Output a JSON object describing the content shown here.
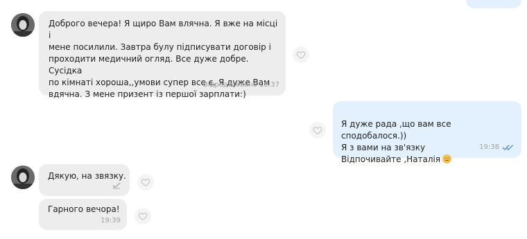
{
  "chat": {
    "messages": [
      {
        "id": "m1",
        "direction": "incoming",
        "lines": "Доброго вечера! Я щиро Вам влячна. Я вже на місці і\nмене посилили. Завтра булу підписувати договір і\nпроходити медичний огляд. Все дуже добре. Сусідка\nпо кімнаті хороша,,умови супер все є. Я дуже Вам\nвдячна. З мене призент із першої зарплати:)",
        "status": "Відредаговано",
        "time": "19:37"
      },
      {
        "id": "m2",
        "direction": "outgoing",
        "lines": "Я дуже рада ,що вам все сподобалося.))\nЯ з вами на зв'язку\nВідпочивайте ,Наталія",
        "emoji": "smiling-face-icon",
        "time": "19:38",
        "read_status": "double-check-icon"
      },
      {
        "id": "m3",
        "direction": "incoming",
        "lines": "Дякую, на звязку.",
        "time": ""
      },
      {
        "id": "m4",
        "direction": "incoming",
        "lines": "Гарного вечора!",
        "time": "19:39"
      }
    ]
  },
  "colors": {
    "incoming_bubble": "#ededed",
    "outgoing_bubble": "#e3f0fd",
    "meta_text": "#a0a0a0",
    "read_check": "#4f8fd6"
  }
}
